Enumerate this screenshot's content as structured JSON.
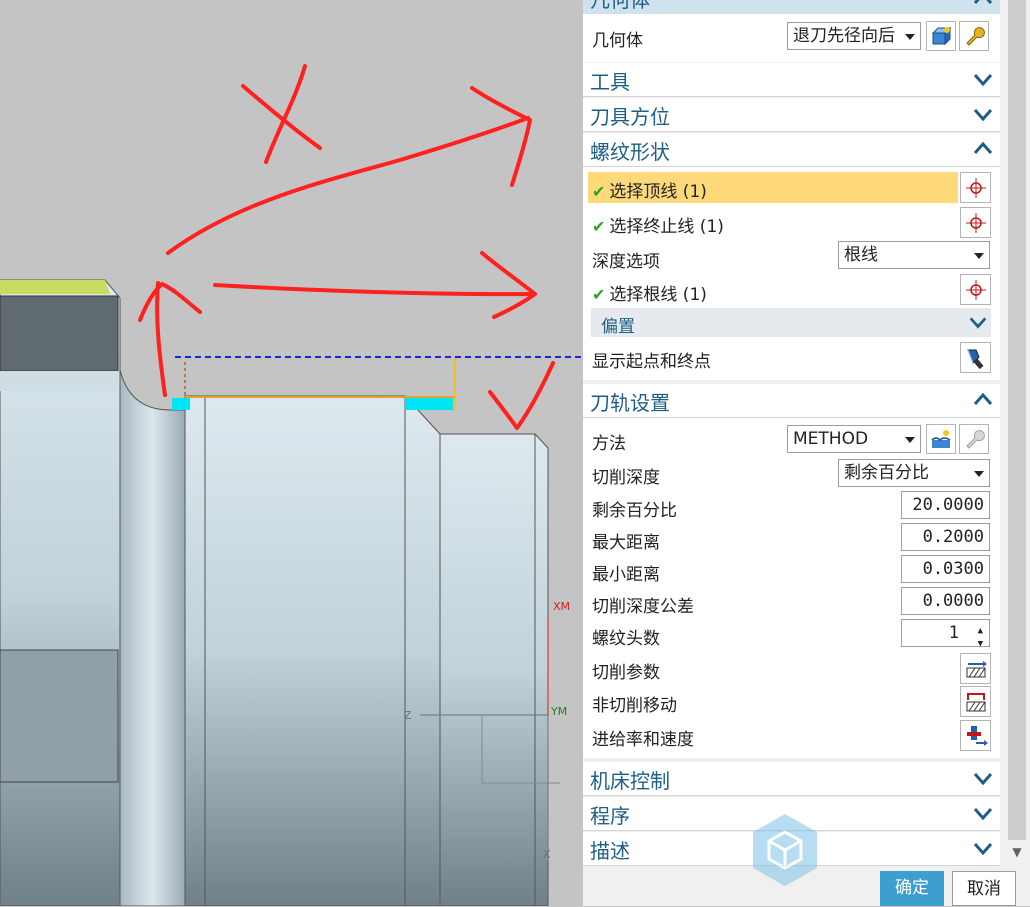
{
  "geometry_section": {
    "title": "几何体",
    "label": "几何体",
    "value": "退刀先径向后",
    "icons": [
      "geometry-icon",
      "wrench-icon"
    ]
  },
  "tool_section": {
    "title": "工具"
  },
  "tool_orientation_section": {
    "title": "刀具方位"
  },
  "thread_shape_section": {
    "title": "螺纹形状",
    "select_top_line": "选择顶线 (1)",
    "select_end_line": "选择终止线 (1)",
    "depth_option_label": "深度选项",
    "depth_option_value": "根线",
    "select_root_line": "选择根线 (1)",
    "offset_label": "偏置",
    "show_start_end_label": "显示起点和终点"
  },
  "path_settings_section": {
    "title": "刀轨设置",
    "method_label": "方法",
    "method_value": "METHOD",
    "cut_depth_label": "切削深度",
    "cut_depth_value": "剩余百分比",
    "remaining_percent_label": "剩余百分比",
    "remaining_percent_value": "20.0000",
    "max_distance_label": "最大距离",
    "max_distance_value": "0.2000",
    "min_distance_label": "最小距离",
    "min_distance_value": "0.0300",
    "cut_depth_tolerance_label": "切削深度公差",
    "cut_depth_tolerance_value": "0.0000",
    "thread_count_label": "螺纹头数",
    "thread_count_value": "1",
    "cut_params_label": "切削参数",
    "non_cut_moves_label": "非切削移动",
    "feeds_speeds_label": "进给率和速度"
  },
  "machine_control_section": {
    "title": "机床控制"
  },
  "program_section": {
    "title": "程序"
  },
  "description_section": {
    "title": "描述"
  },
  "footer": {
    "ok_label": "确定",
    "cancel_label": "取消"
  },
  "viewport": {
    "axis_xm": "XM",
    "axis_ym": "YM",
    "axis_z": "Z",
    "axis_x": "X"
  },
  "colors": {
    "accent": "#1d5f86",
    "highlight": "#fdd97a",
    "check": "#28a428",
    "annotation": "#ff2020",
    "ok_button": "#3c9fd0"
  }
}
